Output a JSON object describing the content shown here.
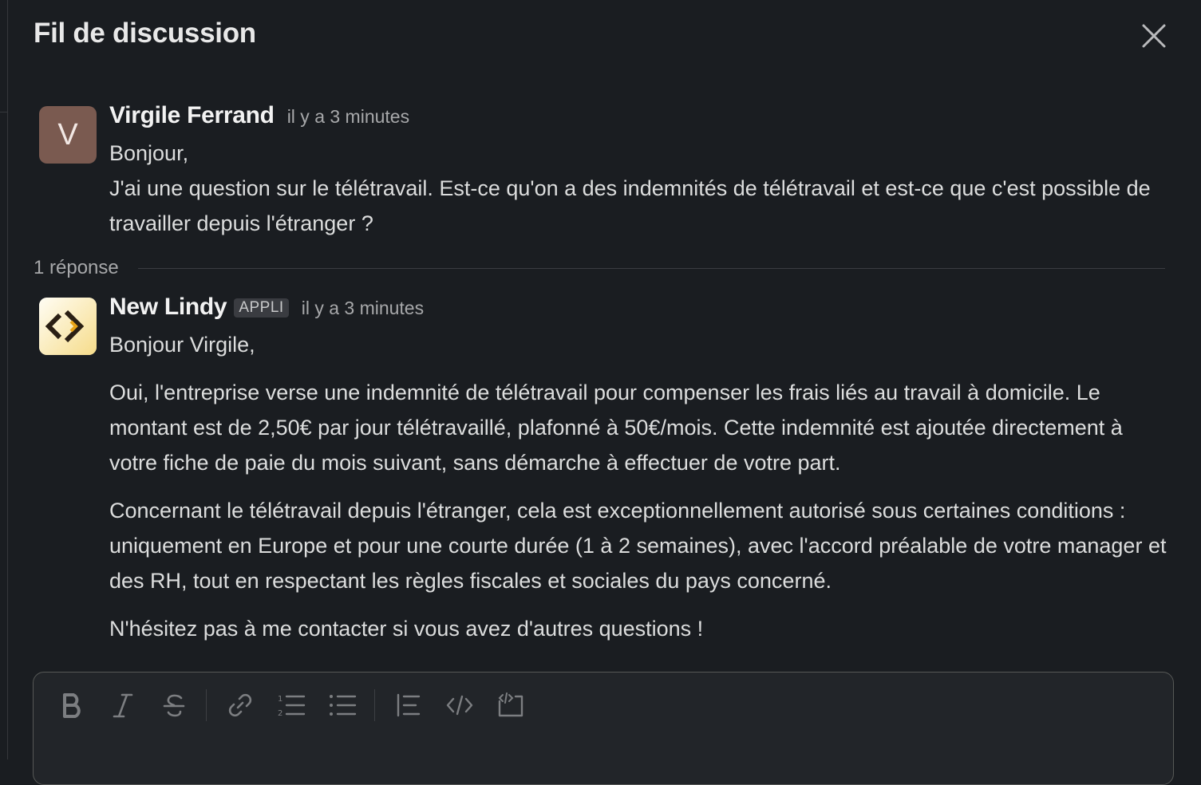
{
  "header": {
    "title": "Fil de discussion"
  },
  "thread": {
    "root": {
      "avatar_letter": "V",
      "author": "Virgile Ferrand",
      "time": "il y a 3 minutes",
      "lines": [
        "Bonjour,",
        "J'ai une question sur le télétravail. Est-ce qu'on a des indemnités de télétravail et est-ce que c'est possible de travailler depuis l'étranger ?"
      ]
    },
    "replies_count_label": "1 réponse",
    "reply": {
      "author": "New Lindy",
      "badge": "APPLI",
      "time": "il y a 3 minutes",
      "greeting": "Bonjour Virgile,",
      "paragraphs": [
        "Oui, l'entreprise verse une indemnité de télétravail pour compenser les frais liés au travail à domicile. Le montant est de 2,50€ par jour télétravaillé, plafonné à 50€/mois. Cette indemnité est ajoutée directement à votre fiche de paie du mois suivant, sans démarche à effectuer de votre part.",
        "Concernant le télétravail depuis l'étranger, cela est exceptionnellement autorisé sous certaines conditions : uniquement en Europe et pour une courte durée (1 à 2 semaines), avec l'accord préalable de votre manager et des RH, tout en respectant les règles fiscales et sociales du pays concerné.",
        "N'hésitez pas à me contacter si vous avez d'autres questions !"
      ]
    }
  },
  "composer": {
    "toolbar": [
      "bold-icon",
      "italic-icon",
      "strikethrough-icon",
      "link-icon",
      "ordered-list-icon",
      "bulleted-list-icon",
      "blockquote-icon",
      "code-icon",
      "code-block-icon"
    ]
  },
  "colors": {
    "background": "#1a1d21",
    "avatar_v": "#7a5a50",
    "lindy_logo_bg": "#fbf6e4",
    "lindy_logo_accent": "#e8a317"
  }
}
